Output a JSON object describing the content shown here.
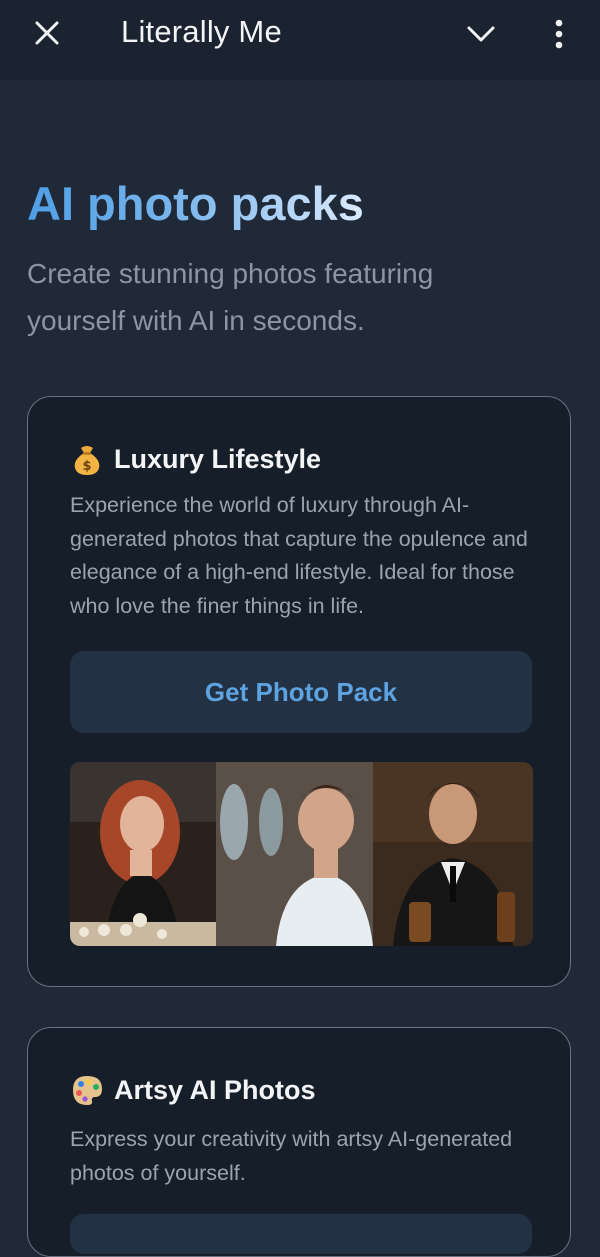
{
  "topbar": {
    "title": "Literally Me",
    "close_icon": "close-icon",
    "chevron_icon": "chevron-down-icon",
    "more_icon": "more-vertical-icon"
  },
  "hero": {
    "title": "AI photo packs",
    "subtitle": "Create stunning photos featuring yourself with AI in seconds."
  },
  "packs": [
    {
      "icon": "money-bag-icon",
      "title": "Luxury Lifestyle",
      "description": "Experience the world of luxury through AI-generated photos that capture the opulence and elegance of a high-end lifestyle. Ideal for those who love the finer things in life.",
      "button_label": "Get Photo Pack"
    },
    {
      "icon": "artist-palette-icon",
      "title": "Artsy AI Photos",
      "description": "Express your creativity with artsy AI-generated photos of yourself."
    }
  ],
  "colors": {
    "background": "#1f2937",
    "card_background": "#161e29",
    "accent": "#5ea3e0"
  }
}
